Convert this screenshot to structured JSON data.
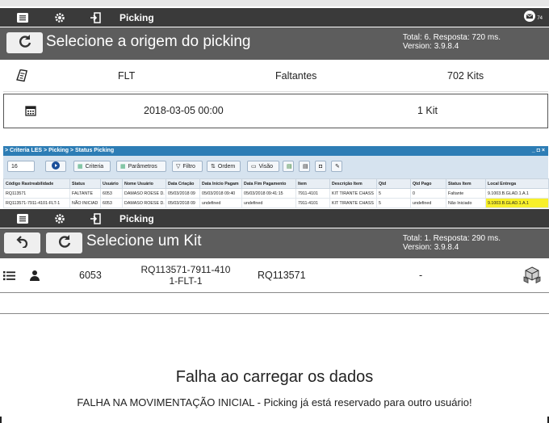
{
  "screen1": {
    "appbar": {
      "title": "Picking",
      "badge": "74"
    },
    "header": {
      "title": "Selecione a origem do picking",
      "info_line1": "Total: 6. Resposta: 720 ms.",
      "info_line2": "Version: 3.9.8.4"
    },
    "row1": {
      "col1": "FLT",
      "col2": "Faltantes",
      "col3": "702 Kits"
    },
    "row2": {
      "date": "2018-03-05 00:00",
      "kits": "1 Kit"
    }
  },
  "criteria": {
    "breadcrumb": "> Criteria LES > Picking > Status Picking",
    "window_controls": "_ ◘ ×",
    "page_size": "16",
    "buttons": {
      "criteria": "Criteria",
      "params": "Parâmetros",
      "filter": "Filtro",
      "order": "Ordem",
      "view": "Visão"
    },
    "columns": [
      "Código Rastreabilidade",
      "Status",
      "Usuário",
      "Nome Usuário",
      "Data Criação",
      "Data Início Pagam",
      "Data Fim Pagamento",
      "Item",
      "Descrição Item",
      "Qtd",
      "Qtd Pago",
      "Status Item",
      "Local Entrega"
    ],
    "rows": [
      [
        "RQ113571",
        "FALTANTE",
        "6053",
        "DAMASO ROESE D.",
        "05/03/2018 09",
        "05/03/2018 09:40",
        "05/03/2018 09:41:15",
        "7911-4101",
        "KIT TIRANTE CHASS",
        "5",
        "0",
        "Faltante",
        "9.1003.B.GLAD.1.A.1"
      ],
      [
        "RQ113571-7911-4101-FLT-1",
        "NÃO INICIAD",
        "6053",
        "DAMASO ROESE D.",
        "05/03/2018 09",
        "undefined",
        "undefined",
        "7911-4101",
        "KIT TIRANTE CHASS",
        "5",
        "undefined",
        "Não Iniciado",
        "9.1003.B.GLAD.1.A.1"
      ]
    ]
  },
  "screen2": {
    "appbar": {
      "title": "Picking"
    },
    "header": {
      "title": "Selecione um Kit",
      "info_line1": "Total: 1. Resposta: 290 ms.",
      "info_line2": "Version: 3.9.8.4"
    },
    "row": {
      "user": "6053",
      "kit_line1": "RQ113571-7911-410",
      "kit_line2": "1-FLT-1",
      "code": "RQ113571",
      "dash": "-"
    }
  },
  "error": {
    "title": "Falha ao carregar os dados",
    "message": "FALHA NA MOVIMENTAÇÃO INICIAL - Picking já está reservado para outro usuário!"
  },
  "colors": {
    "appbar": "#3a3a3a",
    "header": "#5d5d5d",
    "criteria_title": "#2d7db5",
    "highlight": "#f8f02a"
  }
}
